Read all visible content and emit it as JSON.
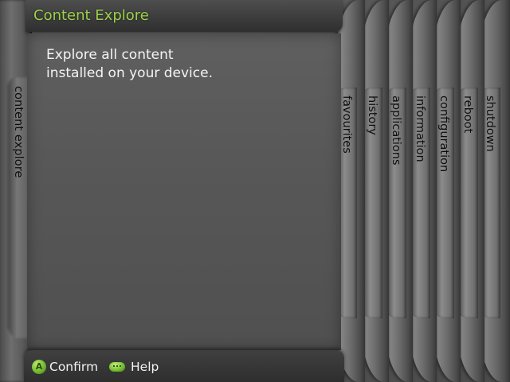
{
  "header": {
    "title": "Content Explore"
  },
  "left_blade": {
    "label": "content explore"
  },
  "main": {
    "description_lines": [
      "Explore all content",
      "installed on your device."
    ]
  },
  "blades": [
    {
      "label": "favourites"
    },
    {
      "label": "history"
    },
    {
      "label": "applications"
    },
    {
      "label": "information"
    },
    {
      "label": "configuration"
    },
    {
      "label": "reboot"
    },
    {
      "label": "shutdown"
    }
  ],
  "footer": {
    "confirm_button_glyph": "A",
    "confirm_label": "Confirm",
    "help_label": "Help"
  },
  "colors": {
    "accent": "#9bd14a",
    "background": "#5a5a5a"
  },
  "icons": {
    "confirm": "a-button-icon",
    "help": "back-button-icon"
  }
}
